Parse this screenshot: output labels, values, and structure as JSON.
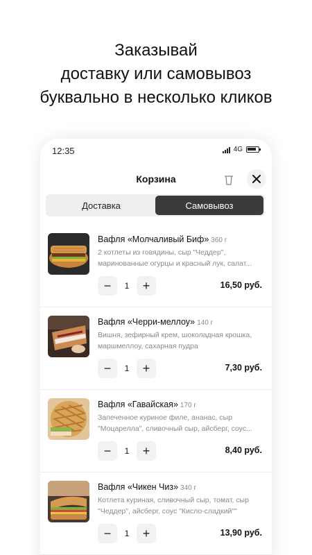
{
  "headline": {
    "line1": "Заказывай",
    "line2": "доставку или самовывоз",
    "line3": "буквально в несколько кликов"
  },
  "status_bar": {
    "time": "12:35",
    "network": "4G"
  },
  "cart": {
    "title": "Корзина",
    "trash_icon": "trash-icon",
    "close_icon": "close-icon"
  },
  "tabs": [
    {
      "label": "Доставка",
      "active": false
    },
    {
      "label": "Самовывоз",
      "active": true
    }
  ],
  "colors": {
    "accent_dark": "#3a3a38",
    "muted_text": "#8a8a8a",
    "tab_bg": "#efefed"
  },
  "items": [
    {
      "name": "Вафля «Молчаливый Биф»",
      "weight": "360 г",
      "description": "2 котлеты из говядины, сыр \"Чеддер\", маринованные огурцы и красный лук, салат...",
      "quantity": "1",
      "price": "16,50 руб."
    },
    {
      "name": "Вафля «Черри-меллоу»",
      "weight": "140 г",
      "description": "Вишня, зефирный крем, шоколадная крошка, маршмеллоу, сахарная пудра",
      "quantity": "1",
      "price": "7,30 руб."
    },
    {
      "name": "Вафля «Гавайская»",
      "weight": "170 г",
      "description": "Запеченное куриное филе, ананас, сыр \"Моцарелла\", сливочный сыр, айсберг, соус...",
      "quantity": "1",
      "price": "8,40 руб."
    },
    {
      "name": "Вафля «Чикен Чиз»",
      "weight": "340 г",
      "description": "Котлета куриная, сливочный сыр, томат, сыр \"Чеддер\", айсберг, соус \"Кисло-сладкий\"\"",
      "quantity": "1",
      "price": "13,90 руб."
    }
  ],
  "controls": {
    "minus": "−",
    "plus": "+"
  }
}
